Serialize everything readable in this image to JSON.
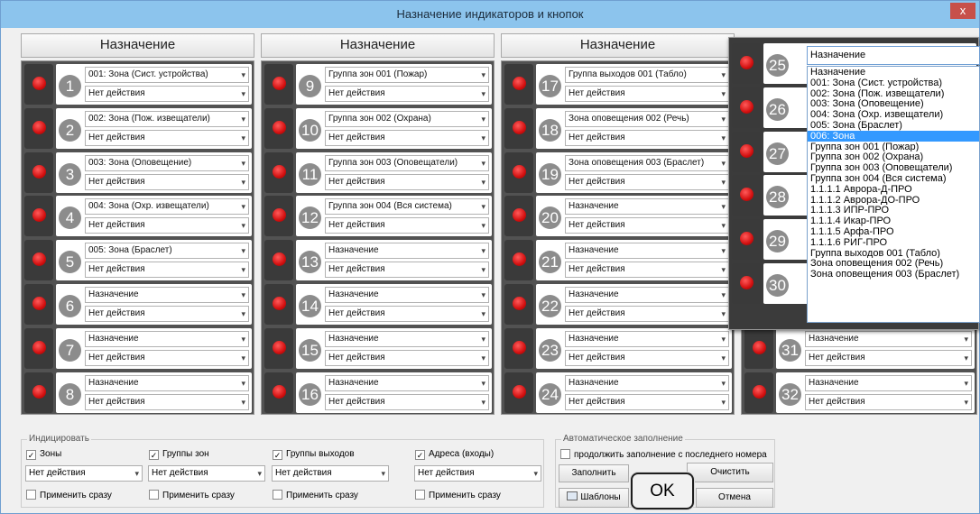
{
  "window": {
    "title": "Назначение индикаторов и кнопок",
    "close_label": "x"
  },
  "header": {
    "label": "Назначение"
  },
  "rows": [
    {
      "n": "1",
      "a": "001: Зона (Сист. устройства)",
      "b": "Нет действия"
    },
    {
      "n": "2",
      "a": "002: Зона (Пож. извещатели)",
      "b": "Нет действия"
    },
    {
      "n": "3",
      "a": "003: Зона (Оповещение)",
      "b": "Нет действия"
    },
    {
      "n": "4",
      "a": "004: Зона (Охр. извещатели)",
      "b": "Нет действия"
    },
    {
      "n": "5",
      "a": "005: Зона (Браслет)",
      "b": "Нет действия"
    },
    {
      "n": "6",
      "a": "Назначение",
      "b": "Нет действия"
    },
    {
      "n": "7",
      "a": "Назначение",
      "b": "Нет действия"
    },
    {
      "n": "8",
      "a": "Назначение",
      "b": "Нет действия"
    },
    {
      "n": "9",
      "a": "Группа зон 001 (Пожар)",
      "b": "Нет действия"
    },
    {
      "n": "10",
      "a": "Группа зон 002 (Охрана)",
      "b": "Нет действия"
    },
    {
      "n": "11",
      "a": "Группа зон 003 (Оповещатели)",
      "b": "Нет действия"
    },
    {
      "n": "12",
      "a": "Группа зон 004 (Вся система)",
      "b": "Нет действия"
    },
    {
      "n": "13",
      "a": "Назначение",
      "b": "Нет действия"
    },
    {
      "n": "14",
      "a": "Назначение",
      "b": "Нет действия"
    },
    {
      "n": "15",
      "a": "Назначение",
      "b": "Нет действия"
    },
    {
      "n": "16",
      "a": "Назначение",
      "b": "Нет действия"
    },
    {
      "n": "17",
      "a": "Группа выходов 001 (Табло)",
      "b": "Нет действия"
    },
    {
      "n": "18",
      "a": "Зона оповещения 002 (Речь)",
      "b": "Нет действия"
    },
    {
      "n": "19",
      "a": "Зона оповещения 003 (Браслет)",
      "b": "Нет действия"
    },
    {
      "n": "20",
      "a": "Назначение",
      "b": "Нет действия"
    },
    {
      "n": "21",
      "a": "Назначение",
      "b": "Нет действия"
    },
    {
      "n": "22",
      "a": "Назначение",
      "b": "Нет действия"
    },
    {
      "n": "23",
      "a": "Назначение",
      "b": "Нет действия"
    },
    {
      "n": "24",
      "a": "Назначение",
      "b": "Нет действия"
    },
    {
      "n": "31",
      "a": "Назначение",
      "b": "Нет действия"
    },
    {
      "n": "32",
      "a": "Назначение",
      "b": "Нет действия"
    }
  ],
  "popup": {
    "numbers": [
      "25",
      "26",
      "27",
      "28",
      "29",
      "30"
    ],
    "input": "Назначение",
    "items": [
      "Назначение",
      "001: Зона (Сист. устройства)",
      "002: Зона (Пож. извещатели)",
      "003: Зона (Оповещение)",
      "004: Зона (Охр. извещатели)",
      "005: Зона (Браслет)",
      "006: Зона",
      "Группа зон 001 (Пожар)",
      "Группа зон 002 (Охрана)",
      "Группа зон 003 (Оповещатели)",
      "Группа зон 004 (Вся система)",
      "1.1.1.1 Аврора-Д-ПРО",
      "1.1.1.2 Аврора-ДО-ПРО",
      "1.1.1.3 ИПР-ПРО",
      "1.1.1.4 Икар-ПРО",
      "1.1.1.5 Арфа-ПРО",
      "1.1.1.6 РИГ-ПРО",
      "Группа выходов 001 (Табло)",
      "Зона оповещения 002 (Речь)",
      "Зона оповещения 003 (Браслет)"
    ],
    "selected_index": 6
  },
  "indicate": {
    "title": "Индицировать",
    "items": [
      {
        "label": "Зоны",
        "checked": true,
        "action": "Нет действия",
        "apply": "Применить сразу"
      },
      {
        "label": "Группы зон",
        "checked": true,
        "action": "Нет действия",
        "apply": "Применить сразу"
      },
      {
        "label": "Группы выходов",
        "checked": true,
        "action": "Нет действия",
        "apply": "Применить сразу"
      },
      {
        "label": "Адреса (входы)",
        "checked": true,
        "action": "Нет действия",
        "apply": "Применить сразу"
      }
    ]
  },
  "autofill": {
    "title": "Автоматическое заполнение",
    "continue_label": "продолжить заполнение с последнего номера",
    "fill": "Заполнить",
    "clear": "Очистить",
    "templates": "Шаблоны",
    "ok": "OK",
    "cancel": "Отмена"
  },
  "colors": {
    "led": "#e01818",
    "title_bar": "#8cc4ed",
    "selection": "#3399ff"
  }
}
